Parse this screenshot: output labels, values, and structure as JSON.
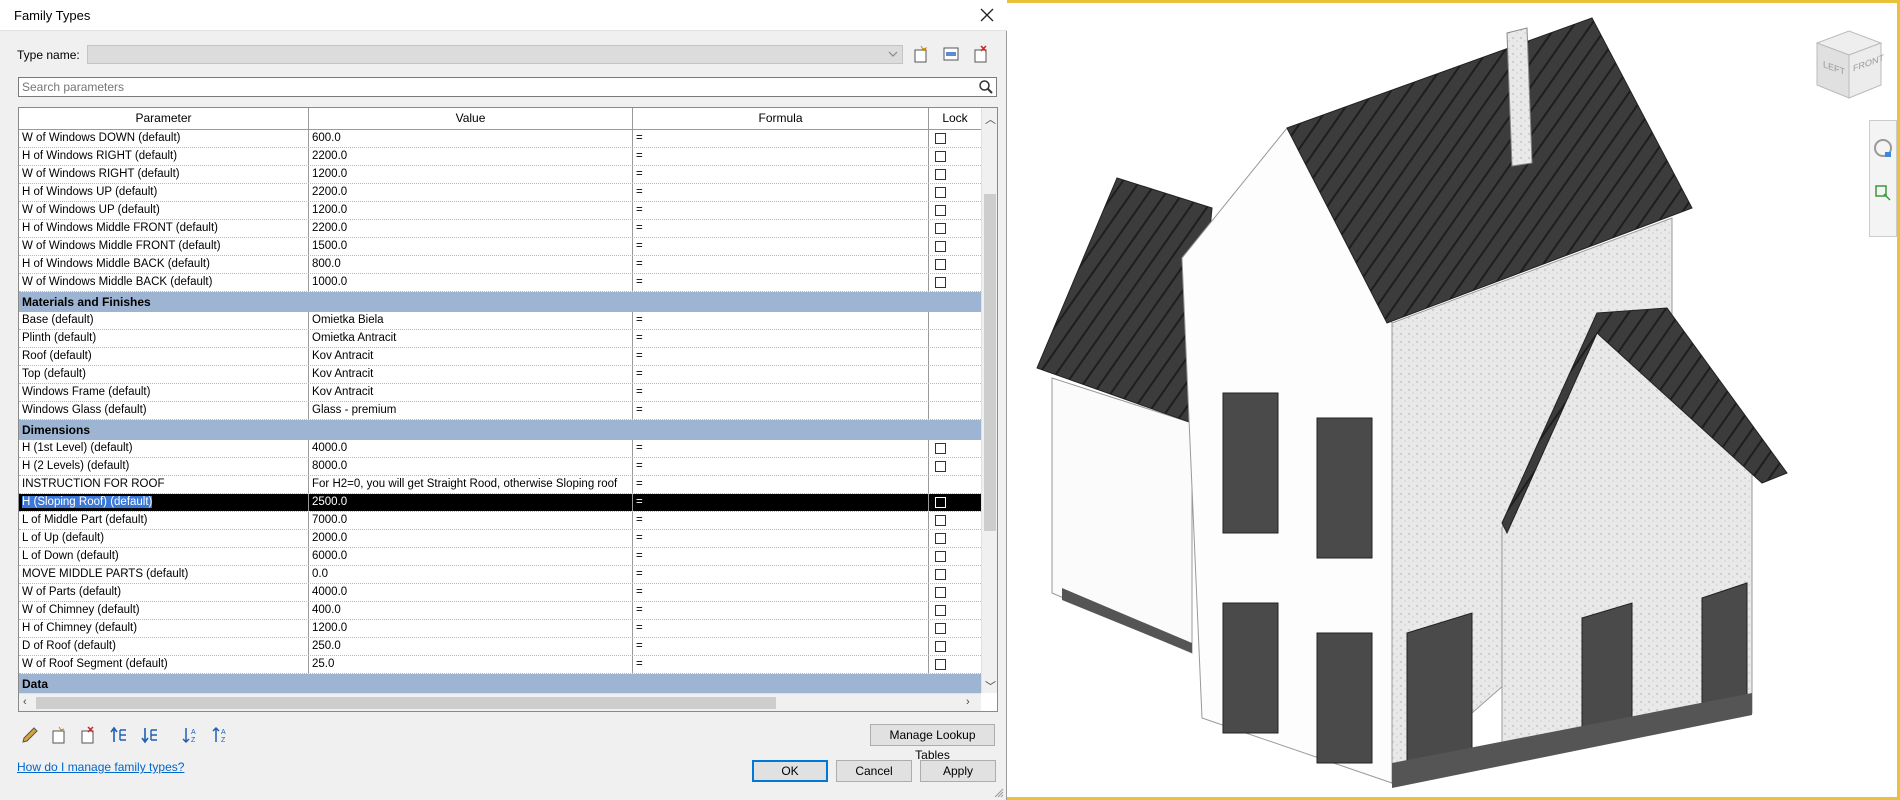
{
  "dialog": {
    "title": "Family Types",
    "type_name_label": "Type name:",
    "type_name_value": "",
    "search_placeholder": "Search parameters"
  },
  "grid": {
    "headers": [
      "Parameter",
      "Value",
      "Formula",
      "Lock"
    ],
    "rows": [
      {
        "param": "W of Windows DOWN (default)",
        "value": "600.0",
        "formula": "=",
        "lock": true
      },
      {
        "param": "H of Windows RIGHT (default)",
        "value": "2200.0",
        "formula": "=",
        "lock": true
      },
      {
        "param": "W of Windows RIGHT (default)",
        "value": "1200.0",
        "formula": "=",
        "lock": true
      },
      {
        "param": "H of Windows  UP (default)",
        "value": "2200.0",
        "formula": "=",
        "lock": true
      },
      {
        "param": "W of Windows UP (default)",
        "value": "1200.0",
        "formula": "=",
        "lock": true
      },
      {
        "param": "H of Windows Middle FRONT (default)",
        "value": "2200.0",
        "formula": "=",
        "lock": true
      },
      {
        "param": "W of Windows Middle FRONT (default)",
        "value": "1500.0",
        "formula": "=",
        "lock": true
      },
      {
        "param": "H of Windows Middle BACK (default)",
        "value": "800.0",
        "formula": "=",
        "lock": true
      },
      {
        "param": "W of Windows Middle BACK (default)",
        "value": "1000.0",
        "formula": "=",
        "lock": true
      },
      {
        "group": "Materials and Finishes"
      },
      {
        "param": "Base (default)",
        "value": "Omietka Biela",
        "formula": "=",
        "lock": false
      },
      {
        "param": "Plinth (default)",
        "value": "Omietka Antracit",
        "formula": "=",
        "lock": false
      },
      {
        "param": "Roof (default)",
        "value": "Kov Antracit",
        "formula": "=",
        "lock": false
      },
      {
        "param": "Top (default)",
        "value": "Kov Antracit",
        "formula": "=",
        "lock": false
      },
      {
        "param": "Windows Frame (default)",
        "value": "Kov Antracit",
        "formula": "=",
        "lock": false
      },
      {
        "param": "Windows Glass (default)",
        "value": "Glass - premium",
        "formula": "=",
        "lock": false
      },
      {
        "group": "Dimensions"
      },
      {
        "param": "H (1st Level) (default)",
        "value": "4000.0",
        "formula": "=",
        "lock": true
      },
      {
        "param": "H (2 Levels) (default)",
        "value": "8000.0",
        "formula": "=",
        "lock": true
      },
      {
        "param": "INSTRUCTION FOR ROOF",
        "value": "For H2=0, you will get Straight Rood, otherwise Sloping roof",
        "formula": "=",
        "lock": false
      },
      {
        "param": "H (Sloping Roof) (default)",
        "value": "2500.0",
        "formula": "=",
        "lock": true,
        "selected": true
      },
      {
        "param": "L of Middle Part (default)",
        "value": "7000.0",
        "formula": "=",
        "lock": true
      },
      {
        "param": "L of Up (default)",
        "value": "2000.0",
        "formula": "=",
        "lock": true
      },
      {
        "param": "L of Down (default)",
        "value": "6000.0",
        "formula": "=",
        "lock": true
      },
      {
        "param": "MOVE MIDDLE PARTS (default)",
        "value": "0.0",
        "formula": "=",
        "lock": true
      },
      {
        "param": "W of Parts (default)",
        "value": "4000.0",
        "formula": "=",
        "lock": true
      },
      {
        "param": "W of Chimney (default)",
        "value": "400.0",
        "formula": "=",
        "lock": true
      },
      {
        "param": "H of Chimney (default)",
        "value": "1200.0",
        "formula": "=",
        "lock": true
      },
      {
        "param": "D of Roof (default)",
        "value": "250.0",
        "formula": "=",
        "lock": true
      },
      {
        "param": "W of Roof Segment (default)",
        "value": "25.0",
        "formula": "=",
        "lock": true
      },
      {
        "group": "Data"
      }
    ]
  },
  "buttons": {
    "manage_lookup": "Manage Lookup Tables",
    "ok": "OK",
    "cancel": "Cancel",
    "apply": "Apply",
    "help_link": "How do I manage family types?"
  },
  "viewcube": {
    "left": "LEFT",
    "front": "FRONT"
  },
  "toolbar_icons": [
    "edit-pencil-icon",
    "new-parameter-icon",
    "delete-parameter-icon",
    "move-up-icon",
    "move-down-icon",
    "sort-ascending-icon",
    "sort-descending-icon"
  ],
  "colors": {
    "group_header": "#9db4d2",
    "selection": "#000000",
    "selection_text_highlight": "#3b78d8",
    "link": "#0066cc",
    "app_frame": "#e8c23a"
  }
}
